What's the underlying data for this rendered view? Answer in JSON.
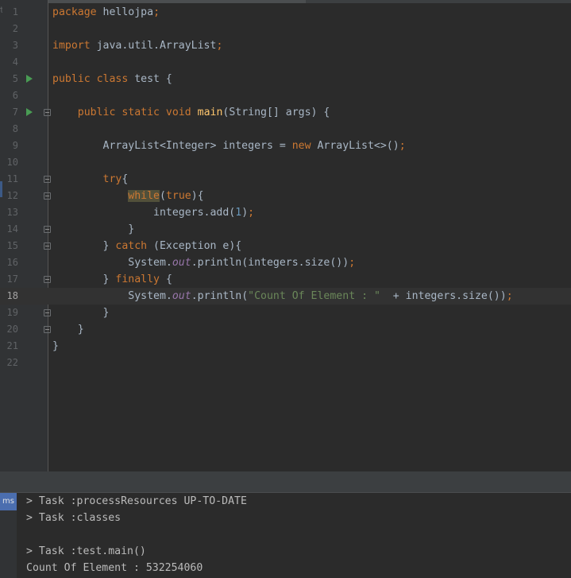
{
  "gutter_glyph": "t",
  "editor": {
    "current_line": 18,
    "lines": [
      {
        "n": "1",
        "tokens": [
          [
            "kw",
            "package "
          ],
          [
            "p",
            "hellojpa"
          ],
          [
            "kw",
            ";"
          ]
        ]
      },
      {
        "n": "2",
        "tokens": []
      },
      {
        "n": "3",
        "tokens": [
          [
            "kw",
            "import "
          ],
          [
            "p",
            "java.util.ArrayList"
          ],
          [
            "kw",
            ";"
          ]
        ]
      },
      {
        "n": "4",
        "tokens": []
      },
      {
        "n": "5",
        "run": true,
        "tokens": [
          [
            "kw",
            "public class "
          ],
          [
            "p",
            "test {"
          ]
        ]
      },
      {
        "n": "6",
        "tokens": []
      },
      {
        "n": "7",
        "run": true,
        "fold": true,
        "tokens": [
          [
            "p",
            "    "
          ],
          [
            "kw",
            "public static void "
          ],
          [
            "fn",
            "main"
          ],
          [
            "p",
            "(String[] args) {"
          ]
        ]
      },
      {
        "n": "8",
        "tokens": []
      },
      {
        "n": "9",
        "tokens": [
          [
            "p",
            "        ArrayList<Integer> integers = "
          ],
          [
            "kw",
            "new "
          ],
          [
            "p",
            "ArrayList<>()"
          ],
          [
            "kw",
            ";"
          ]
        ]
      },
      {
        "n": "10",
        "tokens": []
      },
      {
        "n": "11",
        "fold": true,
        "tokens": [
          [
            "p",
            "        "
          ],
          [
            "kw",
            "try"
          ],
          [
            "p",
            "{"
          ]
        ]
      },
      {
        "n": "12",
        "fold": true,
        "tokens": [
          [
            "p",
            "            "
          ],
          [
            "kwhl",
            "while"
          ],
          [
            "p",
            "("
          ],
          [
            "kw",
            "true"
          ],
          [
            "p",
            "){"
          ]
        ]
      },
      {
        "n": "13",
        "tokens": [
          [
            "p",
            "                integers.add("
          ],
          [
            "num",
            "1"
          ],
          [
            "p",
            ")"
          ],
          [
            "kw",
            ";"
          ]
        ]
      },
      {
        "n": "14",
        "fold": true,
        "tokens": [
          [
            "p",
            "            }"
          ]
        ]
      },
      {
        "n": "15",
        "fold": true,
        "tokens": [
          [
            "p",
            "        } "
          ],
          [
            "kw",
            "catch "
          ],
          [
            "p",
            "(Exception e){"
          ]
        ]
      },
      {
        "n": "16",
        "tokens": [
          [
            "p",
            "            System."
          ],
          [
            "fld",
            "out"
          ],
          [
            "p",
            ".println(integers.size())"
          ],
          [
            "kw",
            ";"
          ]
        ]
      },
      {
        "n": "17",
        "fold": true,
        "tokens": [
          [
            "p",
            "        } "
          ],
          [
            "kw",
            "finally "
          ],
          [
            "p",
            "{"
          ]
        ]
      },
      {
        "n": "18",
        "tokens": [
          [
            "p",
            "            System."
          ],
          [
            "fld",
            "out"
          ],
          [
            "p",
            ".println("
          ],
          [
            "str",
            "\"Count Of Element : \""
          ],
          [
            "p",
            "  + integers.size())"
          ],
          [
            "kw",
            ";"
          ]
        ]
      },
      {
        "n": "19",
        "fold": true,
        "tokens": [
          [
            "p",
            "        }"
          ]
        ]
      },
      {
        "n": "20",
        "fold": true,
        "tokens": [
          [
            "p",
            "    }"
          ]
        ]
      },
      {
        "n": "21",
        "tokens": [
          [
            "p",
            "}"
          ]
        ]
      },
      {
        "n": "22",
        "tokens": []
      }
    ]
  },
  "console": {
    "tab_label": "ms",
    "lines": [
      "> Task :processResources UP-TO-DATE",
      "> Task :classes",
      "",
      "> Task :test.main()",
      "Count Of Element : 532254060"
    ]
  },
  "colors": {
    "background": "#2b2b2b",
    "keyword": "#cc7832",
    "method": "#ffc66d",
    "number": "#6897bb",
    "string": "#6a8759",
    "field": "#9876aa",
    "run_icon": "#499c54",
    "tab_accent": "#4b6eaf"
  },
  "icons": {
    "run": "run-gutter-icon",
    "fold": "fold-marker-icon"
  }
}
